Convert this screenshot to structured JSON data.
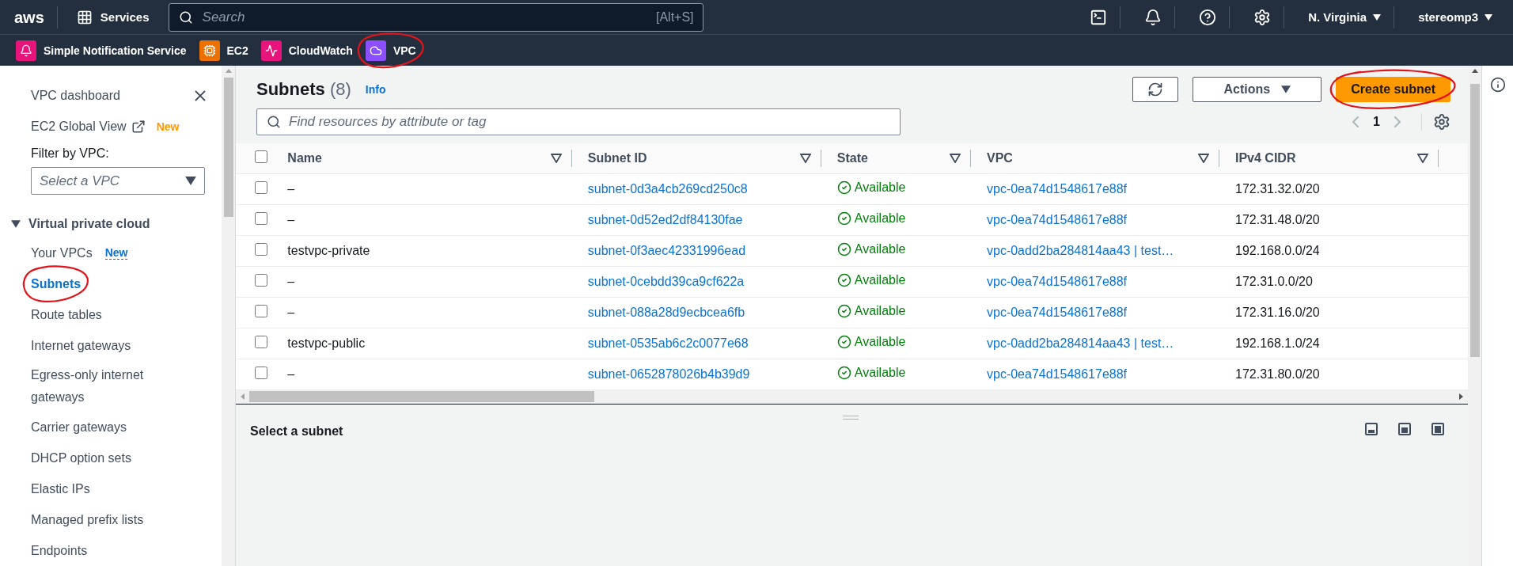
{
  "top_nav": {
    "logo": "aws",
    "services": "Services",
    "search": {
      "placeholder": "Search",
      "shortcut": "[Alt+S]"
    },
    "region": "N. Virginia",
    "account": "stereomp3"
  },
  "favorites": [
    {
      "label": "Simple Notification Service",
      "kind": "sns",
      "color": "#e7157b",
      "circled": false
    },
    {
      "label": "EC2",
      "kind": "ec2",
      "color": "#ed7100",
      "circled": false
    },
    {
      "label": "CloudWatch",
      "kind": "cloudwatch",
      "color": "#e7157b",
      "circled": false
    },
    {
      "label": "VPC",
      "kind": "vpc",
      "color": "#8c4fff",
      "circled": true
    }
  ],
  "sidebar": {
    "top_items": [
      {
        "label": "VPC dashboard",
        "external": false
      },
      {
        "label": "EC2 Global View",
        "external": true,
        "badge": "New"
      }
    ],
    "filter": {
      "label": "Filter by VPC:",
      "placeholder": "Select a VPC"
    },
    "section": {
      "title": "Virtual private cloud",
      "expanded": true,
      "items": [
        {
          "label": "Your VPCs",
          "badge": "New",
          "selected": false,
          "circled": false
        },
        {
          "label": "Subnets",
          "selected": true,
          "circled": true
        },
        {
          "label": "Route tables",
          "selected": false,
          "circled": false
        },
        {
          "label": "Internet gateways",
          "selected": false,
          "circled": false
        },
        {
          "label": "Egress-only internet gateways",
          "selected": false,
          "circled": false
        },
        {
          "label": "Carrier gateways",
          "selected": false,
          "circled": false
        },
        {
          "label": "DHCP option sets",
          "selected": false,
          "circled": false
        },
        {
          "label": "Elastic IPs",
          "selected": false,
          "circled": false
        },
        {
          "label": "Managed prefix lists",
          "selected": false,
          "circled": false
        },
        {
          "label": "Endpoints",
          "selected": false,
          "circled": false
        }
      ]
    }
  },
  "main": {
    "title": "Subnets",
    "count": "(8)",
    "info": "Info",
    "actions": "Actions",
    "create": {
      "label": "Create subnet",
      "circled": true
    },
    "filter": {
      "placeholder": "Find resources by attribute or tag"
    },
    "page": "1"
  },
  "table": {
    "select_all_checked": false,
    "columns": [
      "Name",
      "Subnet ID",
      "State",
      "VPC",
      "IPv4 CIDR"
    ],
    "rows": [
      {
        "selected": false,
        "name": "–",
        "subnet_id": "subnet-0d3a4cb269cd250c8",
        "state": "Available",
        "vpc": "vpc-0ea74d1548617e88f",
        "cidr": "172.31.32.0/20"
      },
      {
        "selected": false,
        "name": "–",
        "subnet_id": "subnet-0d52ed2df84130fae",
        "state": "Available",
        "vpc": "vpc-0ea74d1548617e88f",
        "cidr": "172.31.48.0/20"
      },
      {
        "selected": false,
        "name": "testvpc-private",
        "subnet_id": "subnet-0f3aec42331996ead",
        "state": "Available",
        "vpc": "vpc-0add2ba284814aa43 | test…",
        "cidr": "192.168.0.0/24"
      },
      {
        "selected": false,
        "name": "–",
        "subnet_id": "subnet-0cebdd39ca9cf622a",
        "state": "Available",
        "vpc": "vpc-0ea74d1548617e88f",
        "cidr": "172.31.0.0/20"
      },
      {
        "selected": false,
        "name": "–",
        "subnet_id": "subnet-088a28d9ecbcea6fb",
        "state": "Available",
        "vpc": "vpc-0ea74d1548617e88f",
        "cidr": "172.31.16.0/20"
      },
      {
        "selected": false,
        "name": "testvpc-public",
        "subnet_id": "subnet-0535ab6c2c0077e68",
        "state": "Available",
        "vpc": "vpc-0add2ba284814aa43 | test…",
        "cidr": "192.168.1.0/24"
      },
      {
        "selected": false,
        "name": "–",
        "subnet_id": "subnet-0652878026b4b39d9",
        "state": "Available",
        "vpc": "vpc-0ea74d1548617e88f",
        "cidr": "172.31.80.0/20"
      }
    ]
  },
  "split_panel": {
    "title": "Select a subnet"
  }
}
